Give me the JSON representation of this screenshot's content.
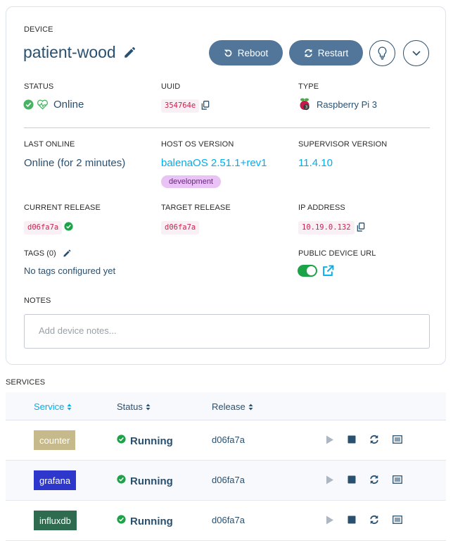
{
  "device": {
    "section_label": "DEVICE",
    "name": "patient-wood",
    "reboot_label": "Reboot",
    "restart_label": "Restart",
    "status_label": "STATUS",
    "status_value": "Online",
    "uuid_label": "UUID",
    "uuid_value": "354764e",
    "type_label": "TYPE",
    "type_value": "Raspberry Pi 3",
    "last_online_label": "LAST ONLINE",
    "last_online_value": "Online (for 2 minutes)",
    "host_os_label": "HOST OS VERSION",
    "host_os_value": "balenaOS 2.51.1+rev1",
    "host_os_badge": "development",
    "supervisor_label": "SUPERVISOR VERSION",
    "supervisor_value": "11.4.10",
    "current_release_label": "CURRENT RELEASE",
    "current_release_value": "d06fa7a",
    "target_release_label": "TARGET RELEASE",
    "target_release_value": "d06fa7a",
    "ip_label": "IP ADDRESS",
    "ip_value": "10.19.0.132",
    "tags_label": "TAGS (0)",
    "tags_empty": "No tags configured yet",
    "public_url_label": "PUBLIC DEVICE URL",
    "public_url_enabled": true,
    "notes_label": "NOTES",
    "notes_placeholder": "Add device notes..."
  },
  "services": {
    "section_label": "SERVICES",
    "columns": {
      "service": "Service",
      "status": "Status",
      "release": "Release"
    },
    "rows": [
      {
        "name": "counter",
        "status": "Running",
        "release": "d06fa7a",
        "color": "#c6b98c"
      },
      {
        "name": "grafana",
        "status": "Running",
        "release": "d06fa7a",
        "color": "#2d37cc"
      },
      {
        "name": "influxdb",
        "status": "Running",
        "release": "d06fa7a",
        "color": "#2f6b4f"
      }
    ]
  },
  "colors": {
    "accent": "#00aeef",
    "primary": "#527699",
    "text": "#2a506f",
    "success": "#1ca348",
    "code_text": "#c7254e"
  }
}
